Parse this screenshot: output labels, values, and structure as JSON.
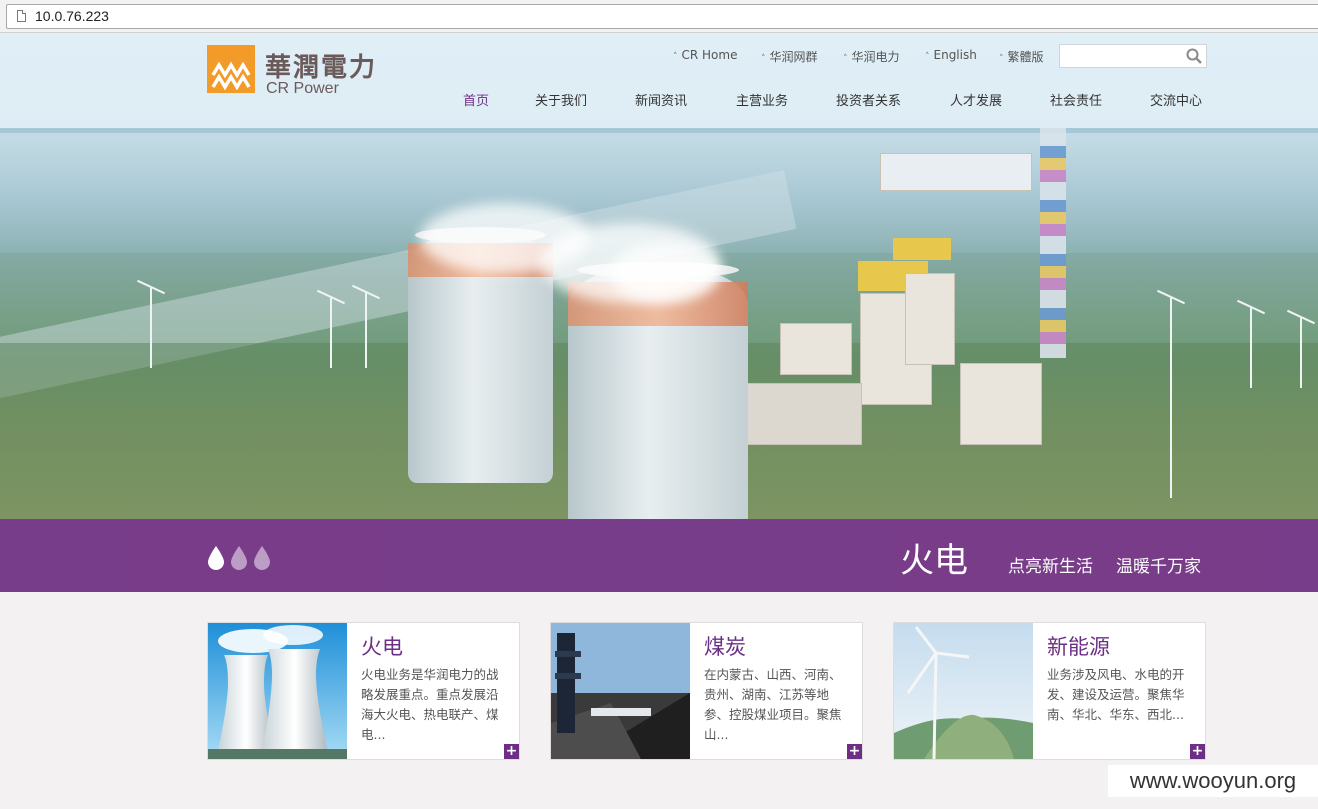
{
  "browser": {
    "url": "10.0.76.223"
  },
  "logo": {
    "cn": "華潤電力",
    "en": "CR Power"
  },
  "top_links": [
    {
      "label": "CR Home"
    },
    {
      "label": "华润网群"
    },
    {
      "label": "华润电力"
    },
    {
      "label": "English"
    },
    {
      "label": "繁體版"
    }
  ],
  "search": {
    "placeholder": ""
  },
  "nav": [
    {
      "label": "首页",
      "active": true
    },
    {
      "label": "关于我们"
    },
    {
      "label": "新闻资讯"
    },
    {
      "label": "主营业务"
    },
    {
      "label": "投资者关系"
    },
    {
      "label": "人才发展"
    },
    {
      "label": "社会责任"
    },
    {
      "label": "交流中心"
    }
  ],
  "banner": {
    "title": "火电",
    "slogan1": "点亮新生活",
    "slogan2": "温暖千万家"
  },
  "cards": [
    {
      "title": "火电",
      "desc": "火电业务是华润电力的战略发展重点。重点发展沿海大火电、热电联产、煤电..."
    },
    {
      "title": "煤炭",
      "desc": "在内蒙古、山西、河南、贵州、湖南、江苏等地参、控股煤业项目。聚焦山..."
    },
    {
      "title": "新能源",
      "desc": "业务涉及风电、水电的开发、建设及运营。聚焦华南、华北、华东、西北..."
    }
  ],
  "watermark": "www.wooyun.org",
  "colors": {
    "brand_purple": "#733585",
    "logo_orange": "#f29b29"
  }
}
